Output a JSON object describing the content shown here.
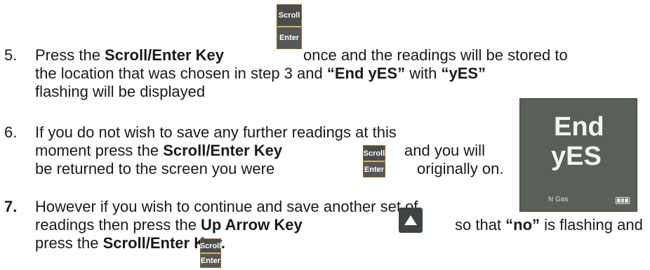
{
  "steps": [
    {
      "number": "5.",
      "lines": [
        {
          "pre": "Press the ",
          "bold": "Scroll/Enter Key",
          "post": ""
        },
        {
          "pre": "once and the readings will be stored to"
        },
        {
          "text": "the location that was chosen in step 3 and "
        },
        {
          "bold1": "“End yES”",
          "mid": " with ",
          "bold2": "“yES”"
        },
        {
          "text": "flashing will be displayed"
        }
      ]
    },
    {
      "number": "6.",
      "lines": [
        {
          "text": "If you do not wish to save any further readings at this"
        },
        {
          "pre": "moment press the ",
          "bold": "Scroll/Enter Key",
          "post": "and you will"
        },
        {
          "pre": "be returned to the screen you were",
          "post": "originally on."
        }
      ]
    },
    {
      "number": "7.",
      "lines": [
        {
          "text": "However if you wish to continue and save another set of"
        },
        {
          "pre": "readings then press the ",
          "bold": "Up Arrow Key",
          "mid": "so that ",
          "bold2": "“no”",
          "post": " is flashing and"
        },
        {
          "pre": "press the ",
          "bold": "Scroll/Enter Key."
        }
      ]
    }
  ],
  "key_labels": {
    "scroll": "Scroll",
    "enter": "Enter"
  },
  "display": {
    "line1": "End",
    "line2": "yES",
    "gas_label": "N  Gas"
  },
  "colors": {
    "key_border": "#d9b25a",
    "key_face": "#4a4d4c",
    "screen_bg": "#5a5f58"
  }
}
